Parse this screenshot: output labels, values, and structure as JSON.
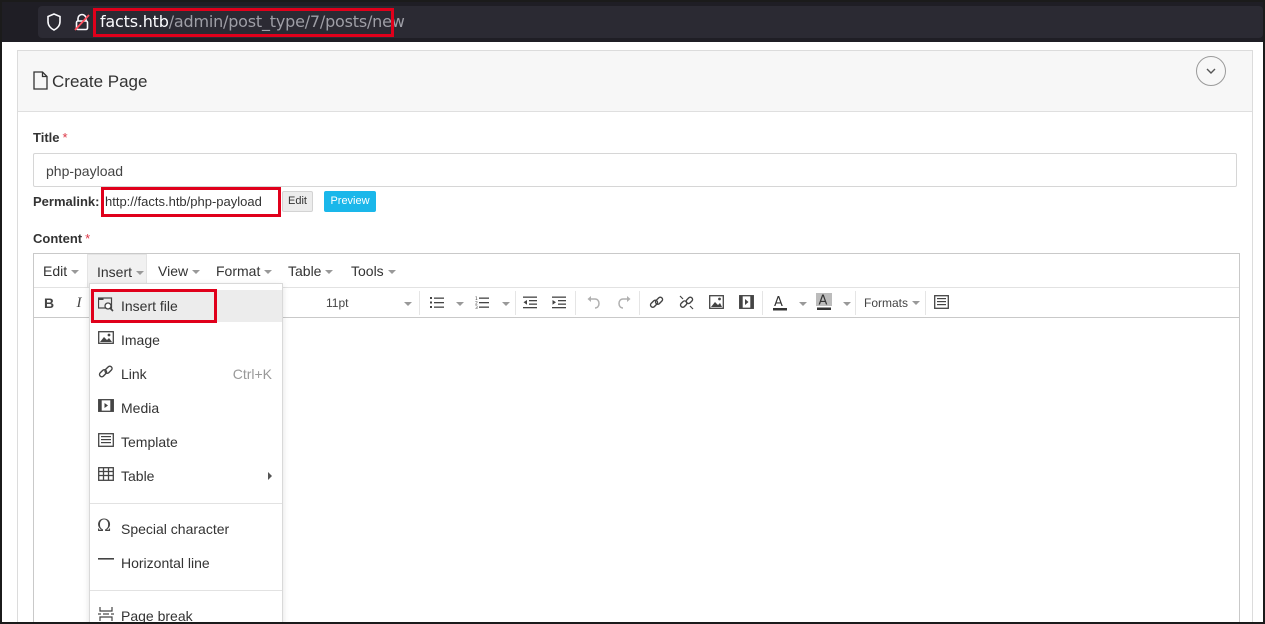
{
  "browser": {
    "url_host": "facts.htb",
    "url_path": "/admin/post_type/7/posts/new"
  },
  "page": {
    "title": "Create Page"
  },
  "form": {
    "title_label": "Title",
    "required_mark": "*",
    "title_value": "php-payload",
    "permalink_label": "Permalink:",
    "permalink_url": "http://facts.htb/php-payload",
    "edit_label": "Edit",
    "preview_label": "Preview",
    "content_label": "Content"
  },
  "editor": {
    "menus": [
      "Edit",
      "Insert",
      "View",
      "Format",
      "Table",
      "Tools"
    ],
    "font_size": "11pt",
    "formats_label": "Formats"
  },
  "insert_menu": {
    "items": [
      {
        "label": "Insert file",
        "icon": "insert-file-icon"
      },
      {
        "label": "Image",
        "icon": "image-icon"
      },
      {
        "label": "Link",
        "icon": "link-icon",
        "shortcut": "Ctrl+K"
      },
      {
        "label": "Media",
        "icon": "media-icon"
      },
      {
        "label": "Template",
        "icon": "template-icon"
      },
      {
        "label": "Table",
        "icon": "table-icon"
      },
      {
        "label": "Special character",
        "icon": "omega-icon"
      },
      {
        "label": "Horizontal line",
        "icon": "horizontal-line-icon"
      },
      {
        "label": "Page break",
        "icon": "page-break-icon"
      }
    ]
  },
  "colors": {
    "highlight_box": "#e0001b",
    "preview_button": "#1ab7ea",
    "url_bar": "#1f1e25"
  }
}
